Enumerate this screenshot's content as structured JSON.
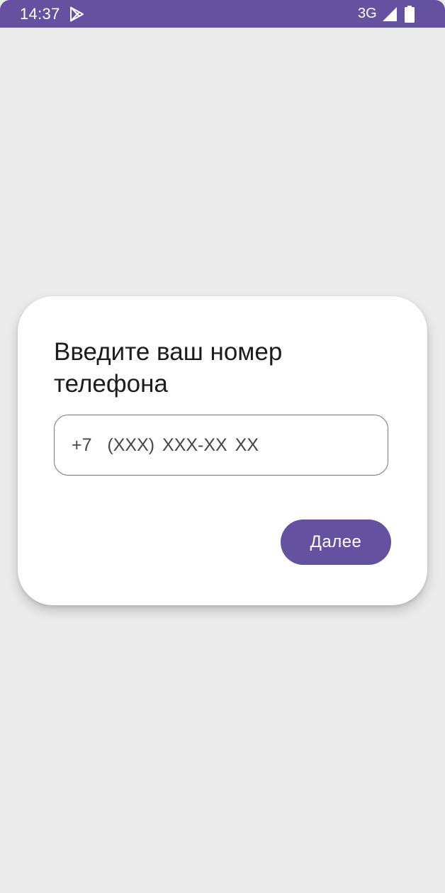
{
  "status_bar": {
    "time": "14:37",
    "network": "3G",
    "background_color": "#6451a0",
    "icons": [
      "play-store-icon",
      "cell-signal-icon",
      "battery-icon"
    ]
  },
  "dialog": {
    "title": "Введите ваш номер телефона",
    "phone_input": {
      "placeholder": "+7  (XXX) XXX-XX XX",
      "value": ""
    },
    "next_button_label": "Далее"
  },
  "colors": {
    "accent": "#6451a0",
    "background": "#ebebeb",
    "card": "#ffffff",
    "outline": "#79747e"
  }
}
